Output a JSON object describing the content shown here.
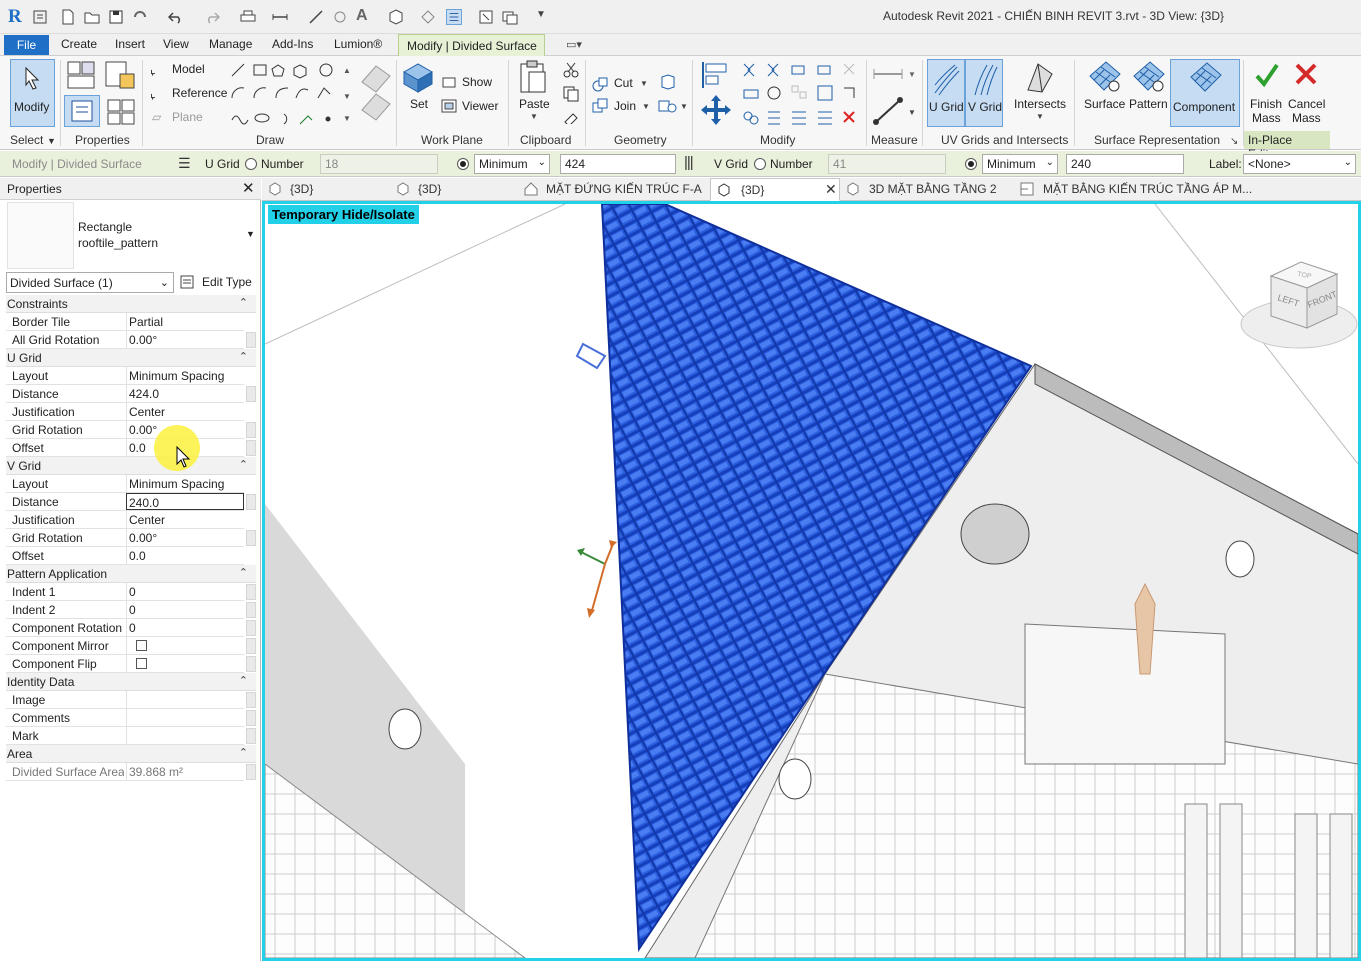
{
  "app": {
    "title": "Autodesk Revit 2021 - CHIẾN BINH REVIT 3.rvt - 3D View: {3D}",
    "logo_letter": "R"
  },
  "menu": {
    "file": "File",
    "items": [
      "Create",
      "Insert",
      "View",
      "Manage",
      "Add-Ins",
      "Lumion®"
    ],
    "context_tab": "Modify | Divided Surface"
  },
  "ribbon": {
    "modify_label": "Modify",
    "select_label": "Select",
    "properties_label": "Properties",
    "draw_label": "Draw",
    "draw_model": "Model",
    "draw_reference": "Reference",
    "draw_plane": "Plane",
    "workplane_label": "Work Plane",
    "set_label": "Set",
    "show_label": "Show",
    "viewer_label": "Viewer",
    "clipboard_label": "Clipboard",
    "paste_label": "Paste",
    "geometry_label": "Geometry",
    "cut_label": "Cut",
    "join_label": "Join",
    "modify_panel_label": "Modify",
    "measure_label": "Measure",
    "uvgrid_u": "U Grid",
    "uvgrid_v": "V Grid",
    "intersects_label": "Intersects",
    "uvgrids_panel_label": "UV Grids and Intersects",
    "surface_label": "Surface",
    "pattern_label": "Pattern",
    "component_label": "Component",
    "surface_rep_label": "Surface Representation",
    "finish_label_1": "Finish",
    "finish_label_2": "Mass",
    "cancel_label_1": "Cancel",
    "cancel_label_2": "Mass",
    "inplace_label": "In-Place Editor"
  },
  "options": {
    "context": "Modify | Divided Surface",
    "ugrid_label": "U Grid",
    "ugrid_number_label": "Number",
    "ugrid_number": "18",
    "ugrid_mode": "Minimum",
    "ugrid_distance": "424",
    "vgrid_label": "V Grid",
    "vgrid_number_label": "Number",
    "vgrid_number": "41",
    "vgrid_mode": "Minimum",
    "vgrid_distance": "240",
    "label_label": "Label:",
    "label_value": "<None>"
  },
  "properties": {
    "title": "Properties",
    "type_name_1": "Rectangle",
    "type_name_2": "rooftile_pattern",
    "selector": "Divided Surface (1)",
    "edit_type": "Edit Type",
    "groups": {
      "constraints": "Constraints",
      "ugrid": "U Grid",
      "vgrid": "V Grid",
      "pattern": "Pattern Application",
      "identity": "Identity Data",
      "area": "Area"
    },
    "rows": {
      "border_tile": {
        "k": "Border Tile",
        "v": "Partial"
      },
      "all_grid_rotation": {
        "k": "All Grid Rotation",
        "v": "0.00°"
      },
      "u_layout": {
        "k": "Layout",
        "v": "Minimum Spacing"
      },
      "u_distance": {
        "k": "Distance",
        "v": "424.0"
      },
      "u_justification": {
        "k": "Justification",
        "v": "Center"
      },
      "u_grid_rotation": {
        "k": "Grid Rotation",
        "v": "0.00°"
      },
      "u_offset": {
        "k": "Offset",
        "v": "0.0"
      },
      "v_layout": {
        "k": "Layout",
        "v": "Minimum Spacing"
      },
      "v_distance": {
        "k": "Distance",
        "v": "240.0"
      },
      "v_justification": {
        "k": "Justification",
        "v": "Center"
      },
      "v_grid_rotation": {
        "k": "Grid Rotation",
        "v": "0.00°"
      },
      "v_offset": {
        "k": "Offset",
        "v": "0.0"
      },
      "indent1": {
        "k": "Indent 1",
        "v": "0"
      },
      "indent2": {
        "k": "Indent 2",
        "v": "0"
      },
      "component_rotation": {
        "k": "Component Rotation",
        "v": "0"
      },
      "component_mirror": {
        "k": "Component Mirror",
        "v": ""
      },
      "component_flip": {
        "k": "Component Flip",
        "v": ""
      },
      "image": {
        "k": "Image",
        "v": ""
      },
      "comments": {
        "k": "Comments",
        "v": ""
      },
      "mark": {
        "k": "Mark",
        "v": ""
      },
      "area": {
        "k": "Divided Surface Area",
        "v": "39.868 m²"
      }
    }
  },
  "view_tabs": [
    "{3D}",
    "{3D}",
    "MẶT ĐỨNG KIẾN TRÚC F-A",
    "{3D}",
    "3D MẶT BẰNG TẦNG 2",
    "MẶT BẰNG KIẾN TRÚC TẦNG ÁP M..."
  ],
  "viewport": {
    "temp_label": "Temporary Hide/Isolate",
    "viewcube_top": "TOP",
    "viewcube_left": "LEFT",
    "viewcube_front": "FRONT"
  },
  "colors": {
    "accent": "#1f6fc6",
    "viewport_border": "#22d0e8",
    "tile_blue": "#1f4fd6",
    "context_green": "#e6f1d6"
  }
}
